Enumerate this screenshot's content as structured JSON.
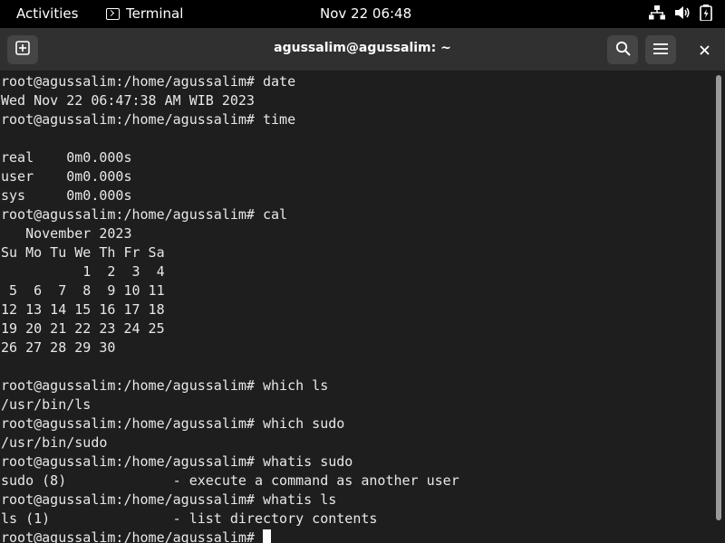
{
  "topbar": {
    "activities": "Activities",
    "app_name": "Terminal",
    "clock": "Nov 22  06:48",
    "icons": [
      "network-icon",
      "volume-icon",
      "battery-icon"
    ]
  },
  "window": {
    "title": "agussalim@agussalim: ~",
    "buttons": [
      "new-tab-icon",
      "search-icon",
      "menu-icon",
      "close-icon"
    ]
  },
  "terminal": {
    "lines": [
      "root@agussalim:/home/agussalim# date",
      "Wed Nov 22 06:47:38 AM WIB 2023",
      "root@agussalim:/home/agussalim# time",
      "",
      "real    0m0.000s",
      "user    0m0.000s",
      "sys     0m0.000s",
      "root@agussalim:/home/agussalim# cal",
      "   November 2023",
      "Su Mo Tu We Th Fr Sa",
      "          1  2  3  4",
      " 5  6  7  8  9 10 11",
      "12 13 14 15 16 17 18",
      "19 20 21 22 23 24 25",
      "26 27 28 29 30",
      "",
      "root@agussalim:/home/agussalim# which ls",
      "/usr/bin/ls",
      "root@agussalim:/home/agussalim# which sudo",
      "/usr/bin/sudo",
      "root@agussalim:/home/agussalim# whatis sudo",
      "sudo (8)             - execute a command as another user",
      "root@agussalim:/home/agussalim# whatis ls",
      "ls (1)               - list directory contents"
    ],
    "prompt": "root@agussalim:/home/agussalim# "
  }
}
